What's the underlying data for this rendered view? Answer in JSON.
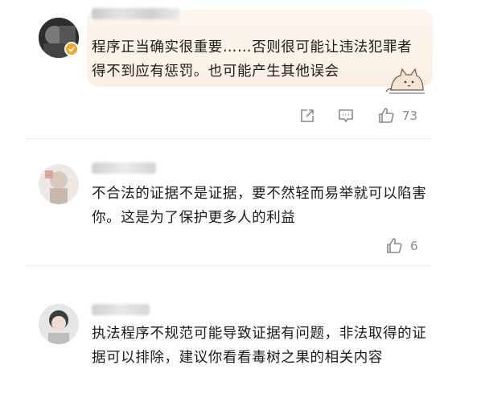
{
  "comments": [
    {
      "text": "程序正当确实很重要……否则很可能让违法犯罪者得不到应有惩罚。也可能产生其他误会",
      "likes": "73"
    },
    {
      "text": "不合法的证据不是证据，要不然轻而易举就可以陷害你。这是为了保护更多人的利益",
      "likes": "6"
    },
    {
      "text": "执法程序不规范可能导致证据有问题，非法取得的证据可以排除，建议你看看毒树之果的相关内容",
      "likes": ""
    }
  ],
  "icons": {
    "share": "share-icon",
    "comment": "comment-icon",
    "like": "thumbs-up-icon",
    "cat": "cat-sticker-icon",
    "verified": "verified-badge-icon"
  },
  "colors": {
    "text": "#1a1a1a",
    "muted": "#8a8a8a",
    "divider": "#ececec",
    "badge": "#f5a623",
    "bubble": "#fbefe2"
  }
}
